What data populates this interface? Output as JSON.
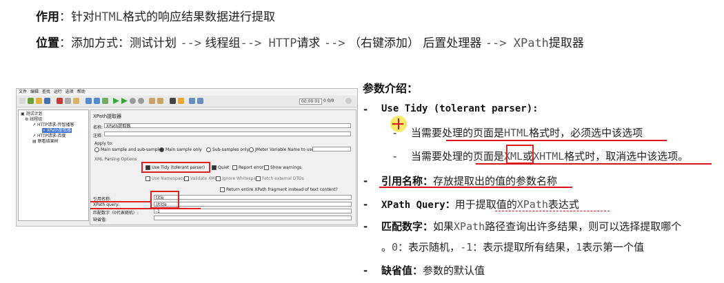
{
  "header": {
    "purpose_label": "作用",
    "purpose_text_a": "：针对",
    "purpose_text_mono": "HTML",
    "purpose_text_b": "格式的响应结果数据进行提取",
    "location_label": "位置",
    "location_text_a": "：添加方式：测试计划 ",
    "location_arrow1": "-->",
    "location_text_b": " 线程组",
    "location_arrow2": "-->",
    "location_mono": " HTTP",
    "location_text_c": "请求 ",
    "location_arrow3": "-->",
    "location_text_d": " （右键添加） 后置处理器 ",
    "location_arrow4": "-->",
    "location_mono2": " XPath",
    "location_text_e": "提取器"
  },
  "jmeter": {
    "menu": [
      "文件",
      "编辑",
      "查找",
      "运行",
      "选项",
      "帮助"
    ],
    "timer": "00:00:01",
    "counter": "0 0/0",
    "tree": [
      "测试计划",
      "线程组",
      "HTTP请求-传智播客",
      "XPath提取器",
      "HTTP请求-百度",
      "察看结果树"
    ],
    "panel_title": "XPath提取器",
    "name_label": "名称:",
    "name_value": "XPath提取器",
    "comment_label": "注释:",
    "apply_to_label": "Apply to:",
    "apply_options": [
      "Main sample and sub-samples",
      "Main sample only",
      "Sub-samples only",
      "JMeter Variable Name to use"
    ],
    "xml_options_label": "XML Parsing Options",
    "use_tidy": "Use Tidy (tolerant parser)",
    "quiet": "Quiet",
    "report_errors": "Report errors",
    "show_warnings": "Show warnings",
    "use_namespaces": "Use Namespaces",
    "validate_xml": "Validate XML",
    "ignore_whitespace": "Ignore Whitespace",
    "fetch_dtds": "Fetch external DTDs",
    "return_fragment": "Return entire XPath fragment instead of text content?",
    "ref_name_label": "引用名称:",
    "ref_name_value": "title",
    "xpath_label": "XPath query:",
    "xpath_value": "//title",
    "match_label": "匹配数字（0代表随机）:",
    "match_value": "-1",
    "default_label": "缺省值:"
  },
  "notes": {
    "title": "参数介绍：",
    "use_tidy_title": "Use Tidy (tolerant parser):",
    "tidy_sub1_a": "当需要处理的页面是",
    "tidy_sub1_mono": "HTML",
    "tidy_sub1_b": "格式时，必须选中该选项",
    "tidy_sub2_a": "当需要处理的页面是",
    "tidy_sub2_mono": "XML",
    "tidy_sub2_b": "或",
    "tidy_sub2_mono2": "XHTML",
    "tidy_sub2_c": "格式时，取消选中该选项。",
    "ref_title": "引用名称：",
    "ref_text": "存放提取出的值的参数名称",
    "xpath_title": "XPath Query：",
    "xpath_text_a": "用于提取值的",
    "xpath_text_mono": "XPath",
    "xpath_text_b": "表达式",
    "match_title": "匹配数字：",
    "match_text_a": "如果",
    "match_text_mono": "XPath",
    "match_text_b": "路径查询出许多结果，则可以选择提取哪个",
    "match_line2_a": "。",
    "match_line2_m1": "0",
    "match_line2_b": "：表示随机，",
    "match_line2_m2": "-1",
    "match_line2_c": "：表示提取所有结果，",
    "match_line2_m3": "1",
    "match_line2_d": "表示第一个值",
    "default_title": "缺省值：",
    "default_text": "参数的默认值",
    "dash": "-"
  },
  "colors": {
    "accent_red": "#d8141c",
    "cursor_yellow": "#f5e33a"
  }
}
